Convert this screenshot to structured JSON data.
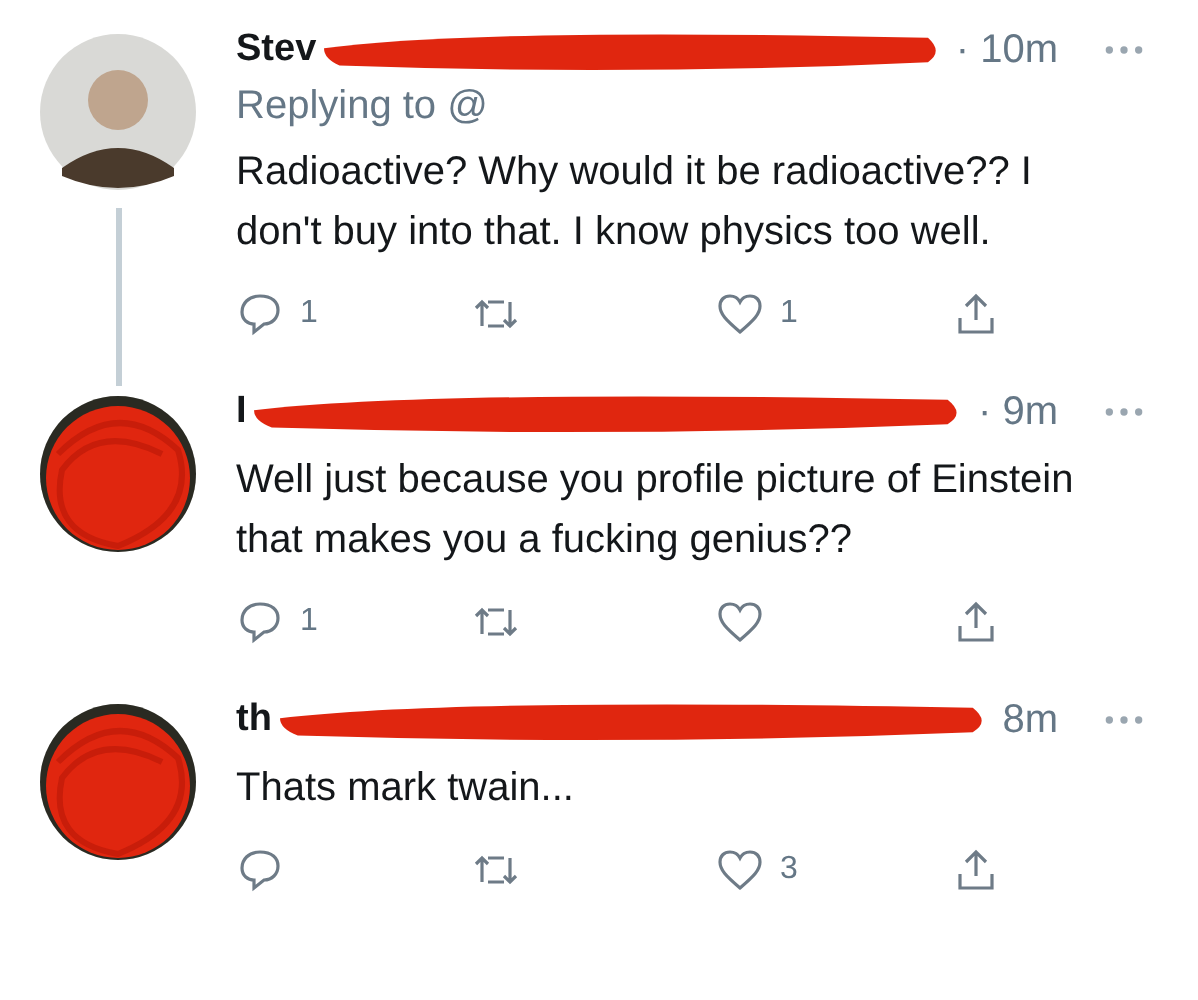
{
  "tweets": [
    {
      "name": "Stev",
      "time": "· 10m",
      "replying_to": "Replying to @",
      "text": "Radioactive? Why would it be radioactive?? I don't buy into that. I know physics too well.",
      "reply_count": "1",
      "like_count": "1",
      "name_redacted": true,
      "avatar_scribbled": false,
      "thread_line": true
    },
    {
      "name": "I",
      "time": "· 9m",
      "text": "Well just because you profile picture of Einstein that makes you a fucking genius??",
      "reply_count": "1",
      "name_redacted": true,
      "avatar_scribbled": true
    },
    {
      "name": "th",
      "time": "8m",
      "text": "Thats mark twain...",
      "like_count": "3",
      "name_redacted": true,
      "avatar_scribbled": true
    }
  ]
}
